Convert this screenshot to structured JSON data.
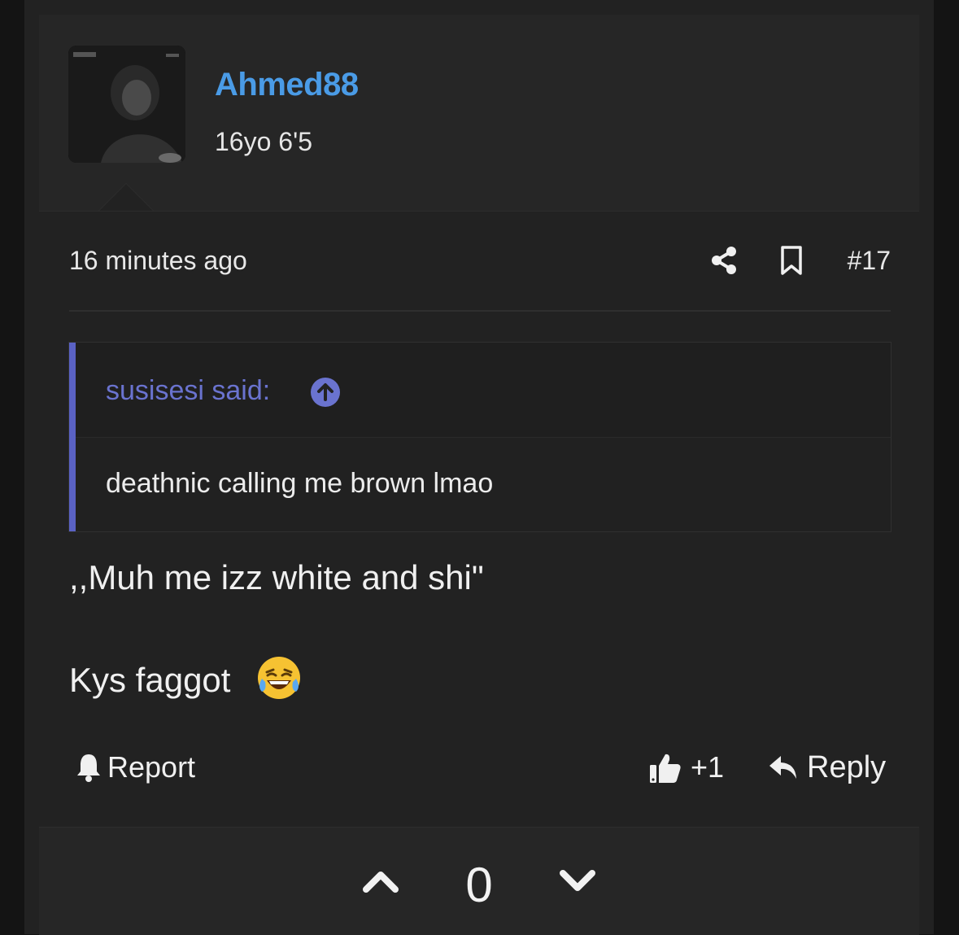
{
  "post": {
    "username": "Ahmed88",
    "user_title": "16yo 6'5",
    "timestamp": "16 minutes ago",
    "post_number": "#17",
    "quote": {
      "author_line": "susisesi said:",
      "text": "deathnic calling me brown lmao"
    },
    "body_line1": ",,Muh me izz white and shi\"",
    "body_line2": "Kys faggot",
    "emoji": "laughing-crying-emoji"
  },
  "actions": {
    "report_label": "Report",
    "like_label": "+1",
    "reply_label": "Reply"
  },
  "votes": {
    "count": "0"
  },
  "colors": {
    "username": "#4a9be6",
    "quote_accent": "#5a62c4",
    "background": "#222222"
  }
}
